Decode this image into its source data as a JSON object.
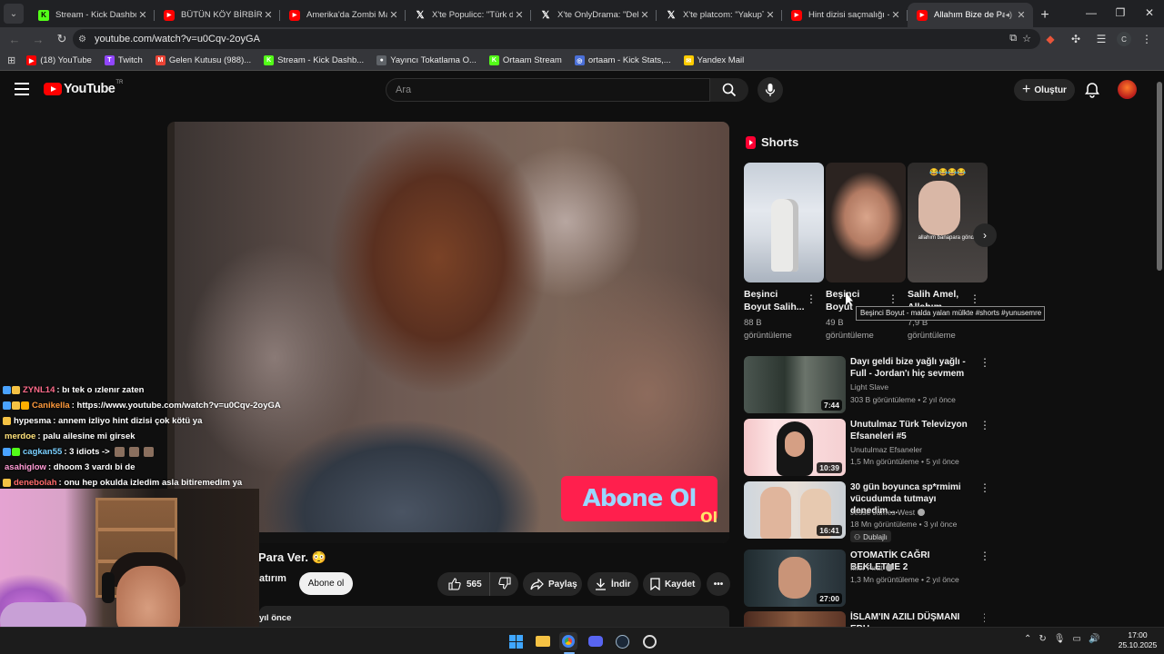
{
  "browser": {
    "tabs": [
      {
        "title": "Stream - Kick Dashboard",
        "favicon": "kick-icon",
        "favicon_text": "K"
      },
      {
        "title": "BÜTÜN KÖY BİRBİRİNE GİRDİ",
        "favicon": "youtube-icon",
        "favicon_text": "▶"
      },
      {
        "title": "Amerika'da Zombi Mahallesi",
        "favicon": "youtube-icon",
        "favicon_text": "▶"
      },
      {
        "title": "X'te Populicc: \"Türk dizileri",
        "favicon": "x-icon",
        "favicon_text": "𝕏"
      },
      {
        "title": "X'te OnlyDrama: \"Deli Mi",
        "favicon": "x-icon",
        "favicon_text": "𝕏"
      },
      {
        "title": "X'te platcom: \"YakupTV,",
        "favicon": "x-icon",
        "favicon_text": "𝕏"
      },
      {
        "title": "Hint dizisi saçmalığı - YouTube",
        "favicon": "youtube-icon",
        "favicon_text": "▶"
      },
      {
        "title": "Allahım Bize de Para",
        "favicon": "youtube-icon",
        "favicon_text": "▶",
        "active": true
      }
    ],
    "url": "youtube.com/watch?v=u0Cqv-2oyGA",
    "bookmarks": [
      {
        "label": "(18) YouTube",
        "icon": "youtube-icon",
        "color": "#ff0000",
        "glyph": "▶"
      },
      {
        "label": "Twitch",
        "icon": "twitch-icon",
        "color": "#9146ff",
        "glyph": "T"
      },
      {
        "label": "Gelen Kutusu (988)...",
        "icon": "gmail-icon",
        "color": "#ea4335",
        "glyph": "M"
      },
      {
        "label": "Stream - Kick Dashb...",
        "icon": "kick-icon",
        "color": "#53fc18",
        "glyph": "K"
      },
      {
        "label": "Yayıncı Tokatlama O...",
        "icon": "globe-icon",
        "color": "#5f6368",
        "glyph": "●"
      },
      {
        "label": "Ortaam Stream",
        "icon": "kick-icon",
        "color": "#53fc18",
        "glyph": "K"
      },
      {
        "label": "ortaam - Kick Stats,...",
        "icon": "stats-icon",
        "color": "#4a6fd8",
        "glyph": "◎"
      },
      {
        "label": "Yandex Mail",
        "icon": "yandex-mail-icon",
        "color": "#ffcc00",
        "glyph": "✉"
      }
    ],
    "profile_initial": "C"
  },
  "youtube": {
    "logo_text": "YouTube",
    "logo_region": "TR",
    "search_placeholder": "Ara",
    "create_label": "Oluştur"
  },
  "video": {
    "title_fragment": "Para Ver. 😳",
    "channel_fragment": "atırım",
    "overlay_badge": "Abone Ol",
    "overlay_small": "Ol",
    "subscribe_label": "Abone ol",
    "likes": "565",
    "share_label": "Paylaş",
    "download_label": "İndir",
    "save_label": "Kaydet",
    "desc_fragment": "yıl önce"
  },
  "shorts": {
    "heading": "Shorts",
    "items": [
      {
        "title": "Beşinci Boyut Salih...",
        "views": "88 B",
        "views_label": "görüntüleme"
      },
      {
        "title": "Beşinci Boyut",
        "views": "49 B",
        "views_label": "görüntüleme"
      },
      {
        "title": "Salih Amel, Allahım para...",
        "views": "7,9 B",
        "views_label": "görüntüleme",
        "thumb_caption": "allahım banapara gönde",
        "thumb_emoji": "😂😂😂😂"
      }
    ],
    "tooltip": "Beşinci Boyut - malda yalan mülkte #shorts #yunusemre"
  },
  "recommendations": [
    {
      "title": "Dayı geldi bize yağlı yağlı - Full - Jordan'ı hiç sevmem",
      "channel": "Light Slave",
      "meta": "303 B görüntüleme • 2 yıl önce",
      "duration": "7:44",
      "verified": false
    },
    {
      "title": "Unutulmaz Türk Televizyon Efsaneleri #5",
      "channel": "Unutulmaz Efsaneler",
      "meta": "1,5 Mn görüntüleme • 5 yıl önce",
      "duration": "10:39",
      "verified": false
    },
    {
      "title": "30 gün boyunca sp*rmimi vücudumda tutmayı denedim ...",
      "channel": "Jesse James West",
      "meta": "18 Mn görüntüleme • 3 yıl önce",
      "duration": "16:41",
      "verified": true,
      "badge": "Dublajlı"
    },
    {
      "title": "OTOMATİK CAĞRI BEKLETME 2",
      "channel": "İlker Fırat",
      "meta": "1,3 Mn görüntüleme • 2 yıl önce",
      "duration": "27:00",
      "verified": true
    },
    {
      "title": "İSLAM'IN AZILI DÜŞMANI EBU",
      "channel": "",
      "meta": "",
      "duration": "",
      "verified": false
    }
  ],
  "chat": [
    {
      "user": "ZYNL14",
      "color": "#ff6b8a",
      "text": ": bı tek o ızlenır zaten",
      "badges": [
        "#4aa3ff",
        "#f5c244"
      ]
    },
    {
      "user": "Canikella",
      "color": "#ff9a3c",
      "text": ": https://www.youtube.com/watch?v=u0Cqv-2oyGA",
      "badges": [
        "#4aa3ff",
        "#f5c244",
        "#ffae00"
      ]
    },
    {
      "user": "hypesma",
      "color": "#ffffff",
      "text": ": annem izliyo hint dizisi çok kötü ya",
      "badges": [
        "#f5c244"
      ]
    },
    {
      "user": "merdoe",
      "color": "#ffe27a",
      "text": ": palu ailesine mi girsek",
      "badges": []
    },
    {
      "user": "cagkan55",
      "color": "#7ad0ff",
      "text": ": 3 idiots ->",
      "badges": [
        "#4aa3ff",
        "#53fc18"
      ],
      "emotes": 3
    },
    {
      "user": "asahiglow",
      "color": "#ff9bd5",
      "text": ": dhoom 3 vardı bi de",
      "badges": []
    },
    {
      "user": "denebolah",
      "color": "#ff6b6b",
      "text": ": onu hep okulda izledim asla bitiremedim ya",
      "badges": [
        "#f5c244"
      ]
    }
  ],
  "taskbar": {
    "time": "17:00",
    "date": "25.10.2025"
  }
}
